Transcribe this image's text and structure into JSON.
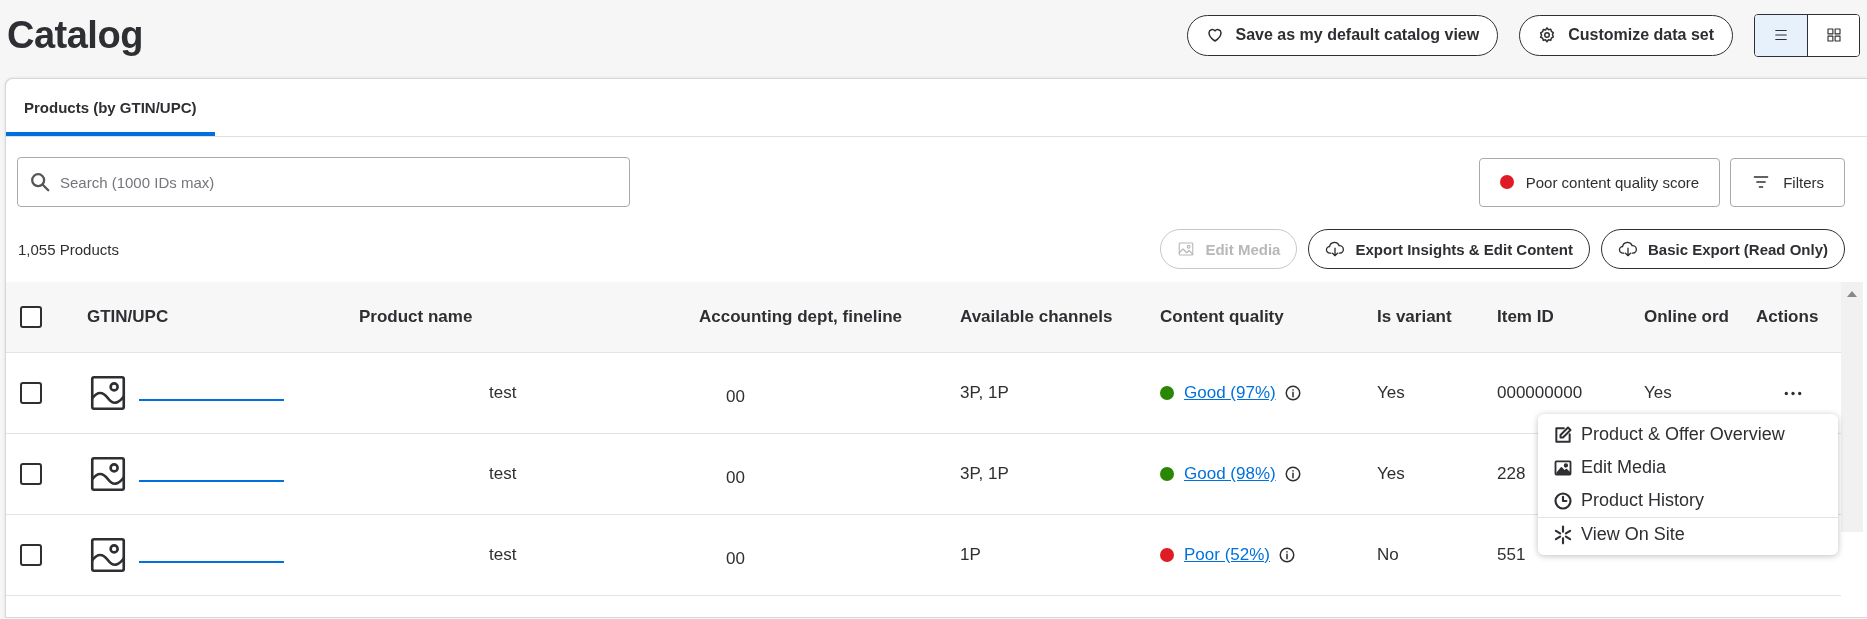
{
  "page": {
    "title": "Catalog"
  },
  "header_buttons": [
    {
      "kind": "favorite",
      "label": "Save as my default catalog view"
    },
    {
      "kind": "customize",
      "label": "Customize data set"
    }
  ],
  "view_toggle": [
    {
      "kind": "list",
      "selected": true
    },
    {
      "kind": "grid",
      "selected": false
    }
  ],
  "tabs": [
    {
      "label": "Products (by GTIN/UPC)",
      "selected": true
    }
  ],
  "search": {
    "placeholder": "Search (1000 IDs max)"
  },
  "filter_buttons": [
    {
      "kind": "quality",
      "label": "Poor content quality score"
    },
    {
      "kind": "filters",
      "label": "Filters"
    }
  ],
  "product_count": "1,055 Products",
  "action_buttons": [
    {
      "kind": "media",
      "label": "Edit Media",
      "disabled": true
    },
    {
      "kind": "export",
      "label": "Export Insights & Edit Content",
      "disabled": false
    },
    {
      "kind": "export",
      "label": "Basic Export (Read Only)",
      "disabled": false
    }
  ],
  "table": {
    "select_all_checked": false,
    "columns": [
      "GTIN/UPC",
      "Product name",
      "Accounting dept, fineline",
      "Available channels",
      "Content quality",
      "Is variant",
      "Item ID",
      "Online ord",
      "Actions"
    ],
    "rows": [
      {
        "checked": false,
        "product_name": "test",
        "accounting": "00",
        "channels": "3P, 1P",
        "quality": {
          "label": "Good (97%)",
          "color": "#2a8703"
        },
        "is_variant": "Yes",
        "item_id": "000000000",
        "online_ord": "Yes",
        "actions_button": true
      },
      {
        "checked": false,
        "product_name": "test",
        "accounting": "00",
        "channels": "3P, 1P",
        "quality": {
          "label": "Good (98%)",
          "color": "#2a8703"
        },
        "is_variant": "Yes",
        "item_id": "228",
        "actions_button": false
      },
      {
        "checked": false,
        "product_name": "test",
        "accounting": "00",
        "channels": "1P",
        "quality": {
          "label": "Poor (52%)",
          "color": "#de1c24"
        },
        "is_variant": "No",
        "item_id": "551",
        "actions_button": false
      }
    ]
  },
  "context_menu": {
    "items": [
      {
        "kind": "edit",
        "label": "Product & Offer Overview",
        "divider_before": false
      },
      {
        "kind": "media",
        "label": "Edit Media",
        "divider_before": false
      },
      {
        "kind": "history",
        "label": "Product History",
        "divider_before": false
      },
      {
        "kind": "site",
        "label": "View On Site",
        "divider_before": true
      }
    ]
  }
}
